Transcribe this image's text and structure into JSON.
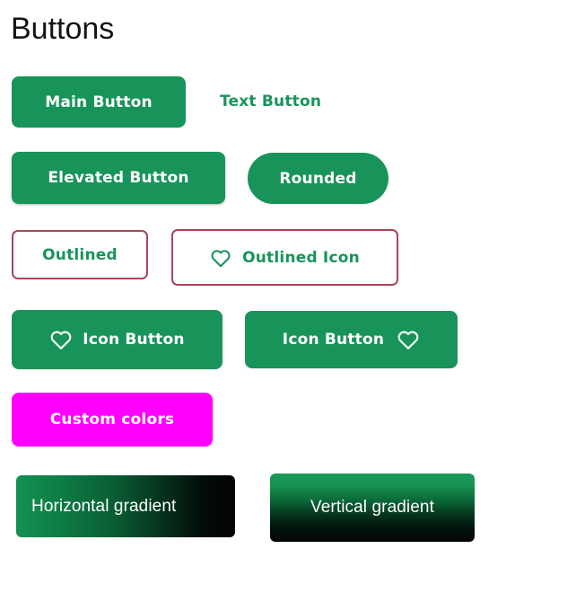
{
  "page": {
    "title": "Buttons",
    "background_color": "#ffffff"
  },
  "theme": {
    "primary_green": "#18945a",
    "text_green": "#19945b",
    "outline_border": "#a9455a",
    "custom_magenta": "#ff00ff",
    "gradient_end": "#030303",
    "on_primary": "#ffffff",
    "title_color": "#141414"
  },
  "buttons": [
    {
      "id": "main",
      "label": "Main Button",
      "variant": "filled",
      "icon": null
    },
    {
      "id": "text",
      "label": "Text Button",
      "variant": "text",
      "icon": null
    },
    {
      "id": "elevated",
      "label": "Elevated Button",
      "variant": "elevated",
      "icon": null
    },
    {
      "id": "rounded",
      "label": "Rounded",
      "variant": "filled-pill",
      "icon": null
    },
    {
      "id": "outlined",
      "label": "Outlined",
      "variant": "outlined",
      "icon": null
    },
    {
      "id": "outlined-icon",
      "label": "Outlined Icon",
      "variant": "outlined",
      "icon": "heart-icon",
      "icon_position": "leading"
    },
    {
      "id": "icon-left",
      "label": "Icon Button",
      "variant": "filled",
      "icon": "heart-icon",
      "icon_position": "leading"
    },
    {
      "id": "icon-right",
      "label": "Icon Button",
      "variant": "filled",
      "icon": "heart-icon",
      "icon_position": "trailing"
    },
    {
      "id": "custom",
      "label": "Custom colors",
      "variant": "filled-custom",
      "icon": null
    },
    {
      "id": "gradient-horizontal",
      "label": "Horizontal gradient",
      "variant": "gradient",
      "gradient_direction": "horizontal",
      "icon": null
    },
    {
      "id": "gradient-vertical",
      "label": "Vertical gradient",
      "variant": "gradient",
      "gradient_direction": "vertical",
      "icon": null
    }
  ]
}
